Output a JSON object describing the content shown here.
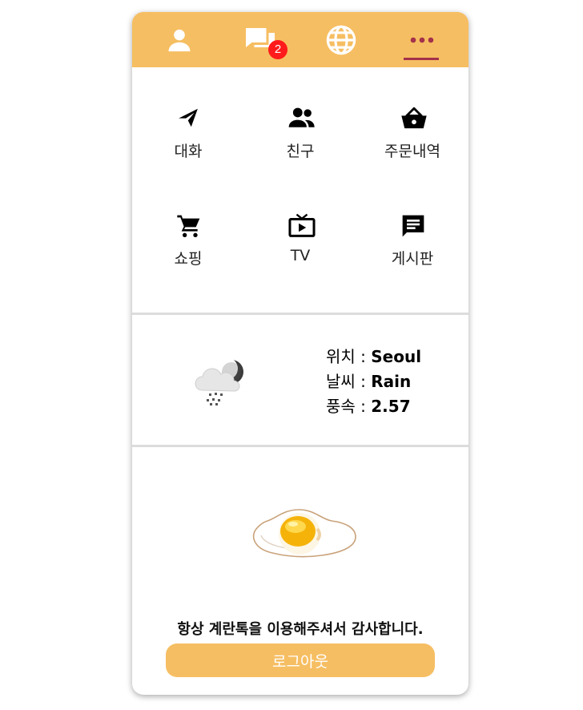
{
  "nav": {
    "items": [
      {
        "icon": "person-icon"
      },
      {
        "icon": "chat-icon",
        "badge": "2"
      },
      {
        "icon": "globe-icon"
      },
      {
        "icon": "more-icon",
        "active": true
      }
    ],
    "accent_color": "#f6be62",
    "active_indicator_color": "#a3324a",
    "badge_color": "#ff1b1b"
  },
  "menu": {
    "items": [
      {
        "label": "대화",
        "icon": "send-icon"
      },
      {
        "label": "친구",
        "icon": "people-icon"
      },
      {
        "label": "주문내역",
        "icon": "basket-icon"
      },
      {
        "label": "쇼핑",
        "icon": "cart-icon"
      },
      {
        "label": "TV",
        "icon": "tv-icon"
      },
      {
        "label": "게시판",
        "icon": "message-icon"
      }
    ]
  },
  "weather": {
    "icon": "rain-night-cloud-icon",
    "location_label": "위치 : ",
    "location": "Seoul",
    "weather_label": "날씨 : ",
    "condition": "Rain",
    "wind_label": "풍속 : ",
    "wind_speed": "2.57"
  },
  "footer": {
    "image": "fried-egg-icon",
    "thanks": "항상 계란톡을 이용해주셔서 감사합니다.",
    "logout_label": "로그아웃"
  }
}
